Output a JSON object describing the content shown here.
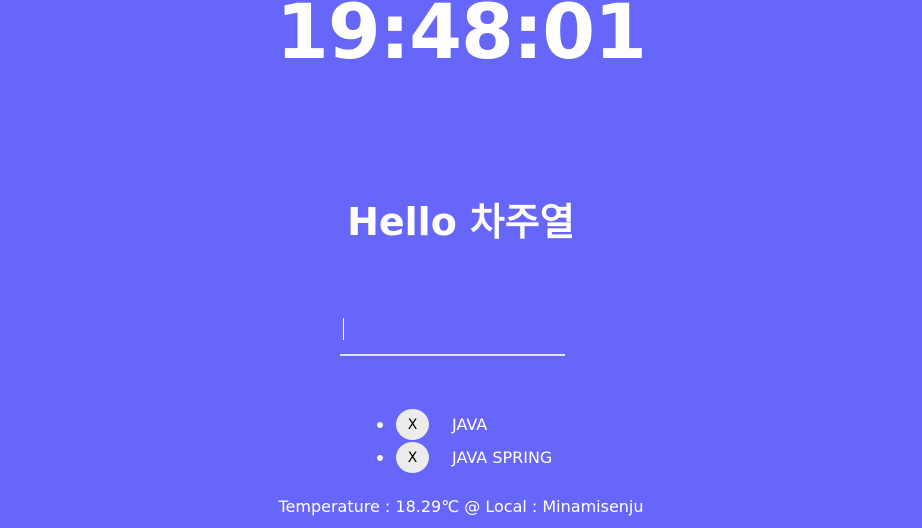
{
  "clock": {
    "time": "19:48:01"
  },
  "greeting": {
    "text": "Hello 차주열"
  },
  "todo_input": {
    "value": "",
    "placeholder": ""
  },
  "todos": [
    {
      "delete_label": "X",
      "text": "JAVA"
    },
    {
      "delete_label": "X",
      "text": "JAVA SPRING"
    }
  ],
  "weather": {
    "text": "Temperature : 18.29℃ @ Local : Minamisenju"
  },
  "colors": {
    "background": "#6666fa",
    "text": "#ffffff",
    "button_bg": "#ececec"
  }
}
